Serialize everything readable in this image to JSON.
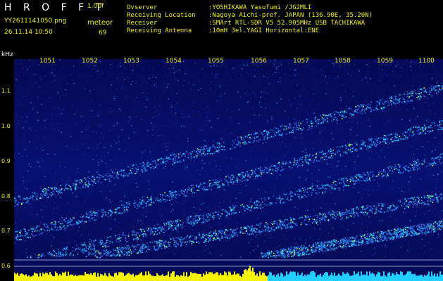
{
  "header": {
    "brand": "H R O F F T",
    "version": "1.00f",
    "filename": "YY2611141050.png",
    "mode_label": "meteor",
    "timestamp": "26.11.14 10:50",
    "count": "69"
  },
  "info": [
    {
      "label": "Ovserver",
      "value": ":YOSHIKAWA Yasufumi /JG2MLI"
    },
    {
      "label": "Receiving Location",
      "value": ":Nagoya Aichi-pref. JAPAN (136.90E, 35.20N)"
    },
    {
      "label": "Receiver",
      "value": ":SMArt RTL-SDR V5 52.905MHz USB TACHIKAWA"
    },
    {
      "label": "Receiving Antenna",
      "value": ":10mH 3el.YAGI Horizontal:ENE"
    }
  ],
  "spectrogram": {
    "unit_label": "kHz",
    "y_ticks": [
      "1.1",
      "1.0",
      "0.9",
      "0.8",
      "0.7",
      "0.6"
    ],
    "x_ticks": [
      "1051",
      "1052",
      "1053",
      "1054",
      "1055",
      "1056",
      "1057",
      "1058",
      "1059",
      "1100"
    ],
    "colors": {
      "background": "#000000",
      "text": "#f3f300",
      "signal": "#21d0ff",
      "hot": "#ffff00"
    }
  }
}
